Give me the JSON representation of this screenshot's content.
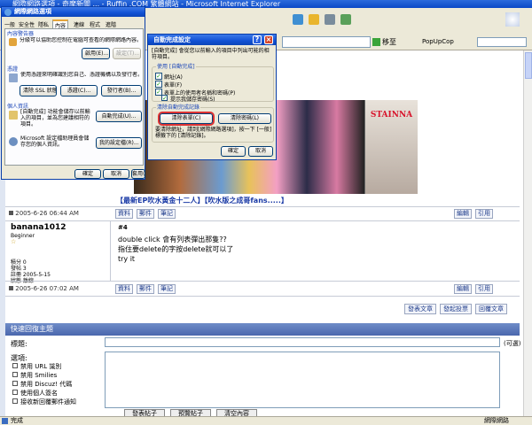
{
  "browser": {
    "title": "網際網路選項 - 奇摩新聞 ...  - Ruffin .COM 繁體網站 - Microsoft Internet Explorer",
    "go_label": "移至",
    "popup_label": "PopUpCop",
    "status_text": "完成",
    "zone_text": "網際網路"
  },
  "internet_options": {
    "title": "網際網路選項",
    "tabs": [
      "一般",
      "安全性",
      "隱私",
      "內容",
      "連線",
      "程式",
      "進階"
    ],
    "content_advisor": {
      "label": "內容警告器",
      "desc": "分級可以協助您控制在電腦可查看的網際網路內容。",
      "enable_btn": "啟用(E)...",
      "settings_btn": "設定(T)..."
    },
    "certificates": {
      "label": "憑證",
      "desc": "使用憑證來明確識別您自己、憑證機構以及發行者。",
      "clear_ssl_btn": "清除 SSL 狀態(S)",
      "certs_btn": "憑證(C)...",
      "publishers_btn": "發行者(B)..."
    },
    "personal": {
      "label": "個人資訊",
      "autocomplete_desc": "[自動完成] 功能會儲存以前輸入的項目，並為您建議相符的項目。",
      "autocomplete_btn": "自動完成(U)...",
      "wallet_desc": "Microsoft 設定檔助理員會儲存您的個人資訊。",
      "profile_btn": "我的設定檔(R)..."
    },
    "ok": "確定",
    "cancel": "取消",
    "apply": "套用(A)"
  },
  "autocomplete_dialog": {
    "title": "自動完成設定",
    "desc": "[自動完成] 會從您以前輸入的項目中列出可能的相符項目。",
    "use_group": "使用 [自動完成]",
    "options": [
      {
        "label": "網址(A)",
        "checked": true
      },
      {
        "label": "表單(F)",
        "checked": true
      },
      {
        "label": "表單上的使用者名稱和密碼(P)",
        "checked": true
      },
      {
        "label": "提示我儲存密碼(S)",
        "checked": true
      }
    ],
    "clear_group": "清除自動完成記錄",
    "clear_forms_btn": "清除表單(C)",
    "clear_passwords_btn": "清除密碼(L)",
    "clear_desc": "要清除網址，請到[網際網路選項]，按一下 [一般] 標籤下的 [清除記錄]。",
    "ok": "確定",
    "cancel": "取消"
  },
  "forum": {
    "banner_caption": "【最新EP吹水黃金十二人】【吹水版之成哥fans.....】",
    "banner_text": "STAINNA",
    "post1_time": "2005-6-26 06:44 AM",
    "post2_time": "2005-6-26 07:02 AM",
    "action_buttons": [
      "資料",
      "郵件",
      "筆記"
    ],
    "edit_btn": "編輯",
    "quote_btn": "引用",
    "post": {
      "author": "banana1012",
      "rank": "Beginner",
      "star": "☆",
      "floor": "#4",
      "lines": [
        "double click 會有列表彈出那隻??",
        "指住要delete的字按delete就可以了",
        "try it"
      ],
      "stats": [
        "積分 0",
        "發帖 3",
        "註冊 2005-5-15",
        "狀態 離線"
      ]
    },
    "bottom_buttons": [
      "發表文章",
      "發起投票",
      "回覆文章"
    ],
    "quick_reply": {
      "header": "快速回復主題",
      "title_label": "標題:",
      "title_hint": "(可選)",
      "options_label": "選項:",
      "options": [
        "禁用 URL 識別",
        "禁用 Smilies",
        "禁用 Discuz! 代碼",
        "使用個人簽名",
        "接收新回覆郵件通知"
      ],
      "submit_buttons": [
        "發表帖子",
        "預覽帖子",
        "清空內容"
      ]
    }
  }
}
